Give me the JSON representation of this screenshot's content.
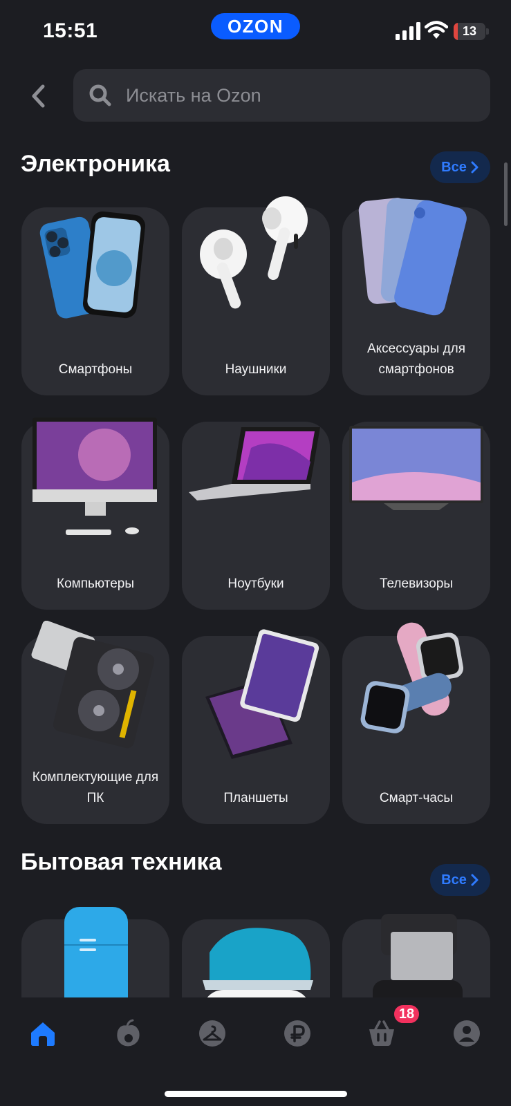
{
  "status_bar": {
    "time": "15:51",
    "brand": "OZON",
    "battery": "13",
    "battery_level": 0.13
  },
  "search": {
    "placeholder": "Искать на Ozon"
  },
  "sections": [
    {
      "title": "Электроника",
      "all_label": "Все",
      "items": [
        {
          "label": "Смартфоны",
          "icon": "smartphones-image"
        },
        {
          "label": "Наушники",
          "icon": "earbuds-image"
        },
        {
          "label": "Аксессуары для смартфонов",
          "icon": "phone-cases-image"
        },
        {
          "label": "Компьютеры",
          "icon": "desktop-computer-image"
        },
        {
          "label": "Ноутбуки",
          "icon": "laptop-image"
        },
        {
          "label": "Телевизоры",
          "icon": "tv-image"
        },
        {
          "label": "Комплектующие для ПК",
          "icon": "pc-parts-image"
        },
        {
          "label": "Планшеты",
          "icon": "tablets-image"
        },
        {
          "label": "Смарт-часы",
          "icon": "smartwatch-image"
        }
      ]
    },
    {
      "title": "Бытовая техника",
      "all_label": "Все",
      "items": [
        {
          "icon": "fridge-image"
        },
        {
          "icon": "iron-image"
        },
        {
          "icon": "coffee-maker-image"
        }
      ]
    }
  ],
  "bottom_nav": {
    "cart_badge": "18",
    "items": [
      "home-icon",
      "fresh-icon",
      "clothes-hanger-icon",
      "ruble-icon",
      "cart-icon",
      "profile-icon"
    ]
  },
  "colors": {
    "background": "#1c1d22",
    "tile": "#2c2d33",
    "accent": "#0a5cff",
    "badge": "#f2315e"
  }
}
